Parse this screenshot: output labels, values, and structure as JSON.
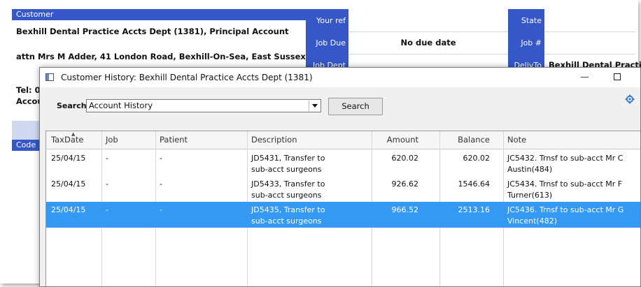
{
  "background_form": {
    "customer_header": "Customer",
    "customer_name": "Bexhill Dental Practice Accts Dept (1381), Principal Account",
    "address": "attn Mrs M Adder, 41 London Road, Bexhill-On-Sea, East Sussex",
    "tel_partial": "Tel: 0",
    "account_partial": "Accou",
    "code_header": "Code",
    "your_ref_label": "Your ref",
    "job_due_label": "Job Due",
    "job_due_value": "No due date",
    "job_dept_label": "Job Dept",
    "state_label": "State",
    "job_num_label": "Job #",
    "deliv_to_label": "DelivTo",
    "deliv_to_value": "Bexhill Dental Practice"
  },
  "dialog": {
    "title": "Customer History: Bexhill Dental Practice Accts Dept (1381)",
    "search_label": "Search",
    "search_combo_value": "Account History",
    "search_button": "Search",
    "columns": {
      "taxdate": "TaxDate",
      "job": "Job",
      "patient": "Patient",
      "description": "Description",
      "amount": "Amount",
      "balance": "Balance",
      "note": "Note"
    },
    "rows": [
      {
        "taxdate": "25/04/15",
        "job": "-",
        "patient": "-",
        "description": "JD5431, Transfer to sub-acct surgeons",
        "amount": "620.02",
        "balance": "620.02",
        "note": "JC5432. Trnsf to sub-acct Mr C Austin(484)"
      },
      {
        "taxdate": "25/04/15",
        "job": "-",
        "patient": "-",
        "description": "JD5433, Transfer to sub-acct surgeons",
        "amount": "926.62",
        "balance": "1546.64",
        "note": "JC5434. Trnsf to sub-acct Mr F Turner(613)"
      },
      {
        "taxdate": "25/04/15",
        "job": "-",
        "patient": "-",
        "description": "JD5435, Transfer to sub-acct surgeons",
        "amount": "966.52",
        "balance": "2513.16",
        "note": "JC5436. Trnsf to sub-acct Mr G Vincent(482)"
      }
    ]
  },
  "colors": {
    "header_blue": "#3557c8",
    "selection_blue": "#3399f3"
  }
}
